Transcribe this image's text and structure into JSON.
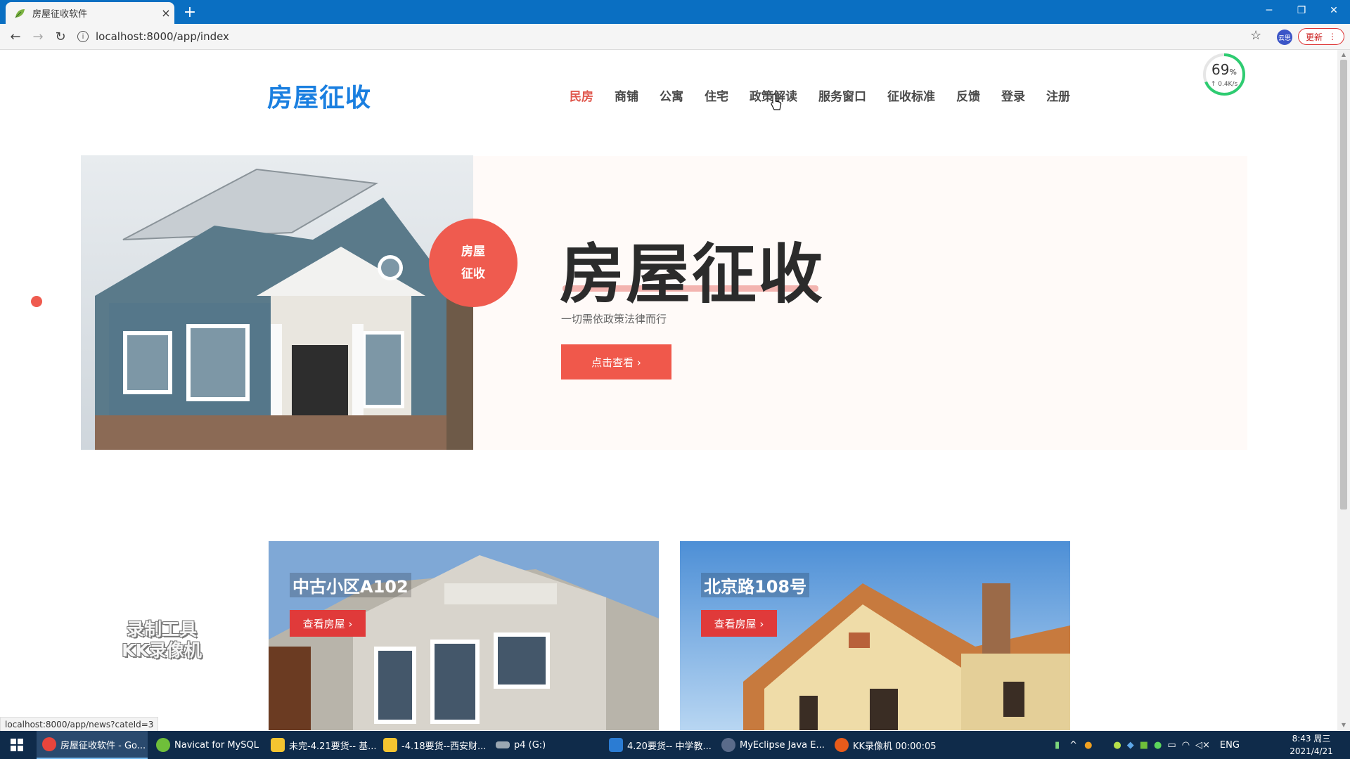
{
  "browser": {
    "tab_title": "房屋征收软件",
    "tab_close": "×",
    "new_tab": "+",
    "url": "localhost:8000/app/index",
    "update_label": "更新",
    "ext_label": "云思",
    "status_url": "localhost:8000/app/news?cateId=3"
  },
  "site": {
    "logo": "房屋征收",
    "nav": [
      {
        "label": "民房",
        "active": true
      },
      {
        "label": "商铺"
      },
      {
        "label": "公寓"
      },
      {
        "label": "住宅"
      },
      {
        "label": "政策解读"
      },
      {
        "label": "服务窗口"
      },
      {
        "label": "征收标准"
      },
      {
        "label": "反馈"
      },
      {
        "label": "登录"
      },
      {
        "label": "注册"
      }
    ]
  },
  "speed_widget": {
    "percent": "69",
    "unit": "%",
    "rate": "↑ 0.4K/s"
  },
  "hero": {
    "badge_line1": "房屋",
    "badge_line2": "征收",
    "title": "房屋征收",
    "subtitle": "一切需依政策法律而行",
    "button": "点击查看 ›"
  },
  "cards": [
    {
      "name": "中古小区A102",
      "button": "查看房屋 ›"
    },
    {
      "name": "北京路108号",
      "button": "查看房屋 ›"
    }
  ],
  "watermark": {
    "line1": "录制工具",
    "line2": "KK录像机"
  },
  "taskbar": {
    "items": [
      {
        "label": "房屋征收软件 - Go...",
        "color": "#e8453c"
      },
      {
        "label": "Navicat for MySQL",
        "color": "#6fbf3a"
      },
      {
        "label": "未完-4.21要货-- 基...",
        "color": "#f4c430"
      },
      {
        "label": "-4.18要货--西安财...",
        "color": "#f4c430"
      },
      {
        "label": "p4 (G:)",
        "color": "#9aa7b2"
      },
      {
        "label": "4.20要货-- 中学教...",
        "color": "#2b7cd3"
      },
      {
        "label": "MyEclipse Java E...",
        "color": "#5a6b8a"
      },
      {
        "label": "KK录像机 00:00:05",
        "color": "#e85b1a"
      }
    ],
    "lang": "ENG",
    "time": "8:43 周三",
    "date": "2021/4/21"
  },
  "colors": {
    "accent": "#ef5b4f",
    "logo": "#1a7fe0",
    "taskbar": "#0f2b4a",
    "tabbar": "#0a6fc2"
  }
}
